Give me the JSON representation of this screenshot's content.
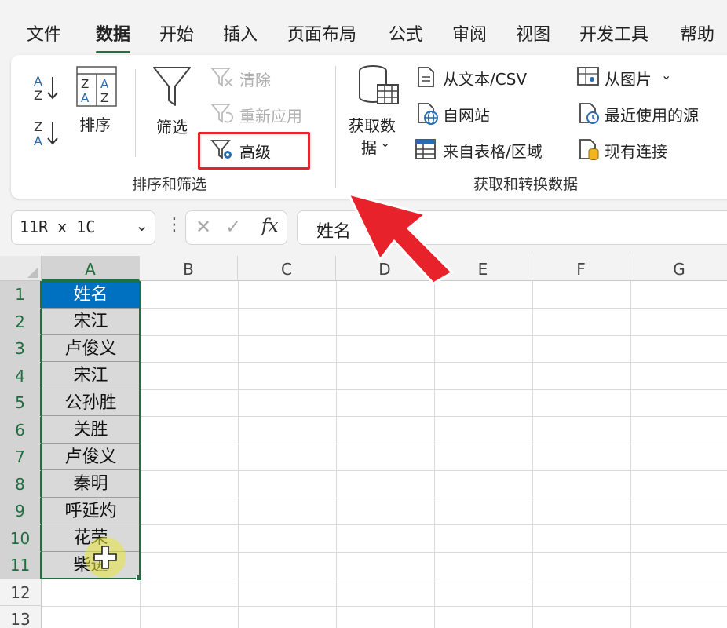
{
  "menu": {
    "tabs": [
      "文件",
      "数据",
      "开始",
      "插入",
      "页面布局",
      "公式",
      "审阅",
      "视图",
      "开发工具",
      "帮助"
    ],
    "active": "数据"
  },
  "ribbon": {
    "sort_filter": {
      "sort_label": "排序",
      "filter_label": "筛选",
      "clear_label": "清除",
      "reapply_label": "重新应用",
      "advanced_label": "高级",
      "group_label": "排序和筛选"
    },
    "get_transform": {
      "get_data_line1": "获取数",
      "get_data_line2": "据",
      "from_text_label": "从文本/CSV",
      "from_web_label": "自网站",
      "from_table_label": "来自表格/区域",
      "from_picture_label": "从图片",
      "recent_sources_label": "最近使用的源",
      "existing_conn_label": "现有连接",
      "group_label": "获取和转换数据"
    }
  },
  "formula_bar": {
    "name_box": "11R x 1C",
    "fx_label": "fx",
    "content": "姓名"
  },
  "grid": {
    "columns": [
      "A",
      "B",
      "C",
      "D",
      "E",
      "F",
      "G"
    ],
    "rows": [
      "1",
      "2",
      "3",
      "4",
      "5",
      "6",
      "7",
      "8",
      "9",
      "10",
      "11",
      "12",
      "13"
    ],
    "column_a": [
      "姓名",
      "宋江",
      "卢俊义",
      "宋江",
      "公孙胜",
      "关胜",
      "卢俊义",
      "秦明",
      "呼延灼",
      "花荣",
      "柴进"
    ]
  },
  "colors": {
    "accent_green": "#1e7145",
    "header_blue": "#0070c0",
    "highlight_red": "#e8222a"
  }
}
